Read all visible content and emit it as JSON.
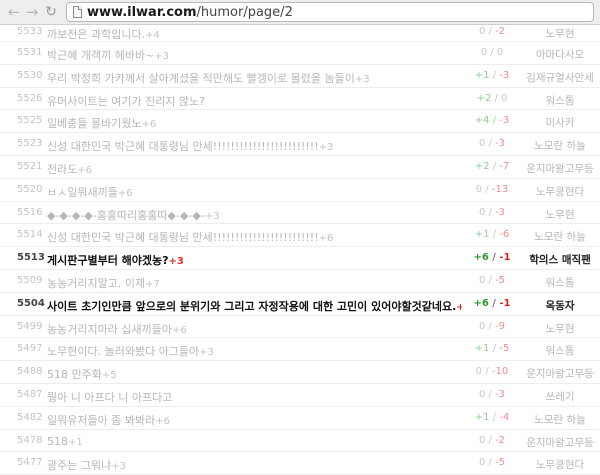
{
  "browser": {
    "url_domain": "www.ilwar.com",
    "url_path": "/humor/page/2",
    "back": "←",
    "forward": "→",
    "reload": "↻"
  },
  "posts": [
    {
      "num": "5533",
      "title": "까보전은 과학입니다.",
      "comments": "+4",
      "up": "0",
      "down": "-2",
      "author": "노무현",
      "hot": false
    },
    {
      "num": "5531",
      "title": "박근혜 개객끼 헤바바~",
      "comments": "+3",
      "up": "0",
      "down": "0",
      "author": "아마다사오",
      "hot": false
    },
    {
      "num": "5530",
      "title": "우리 박정희 가카께서 살아계셨을 적만해도 빨갱이로 몰렸을 놈들이",
      "comments": "+3",
      "up": "+1",
      "down": "-3",
      "author": "김재규열사만세",
      "hot": false
    },
    {
      "num": "5526",
      "title": "유머사이트는 여기가 진리지 않노?",
      "comments": "",
      "up": "+2",
      "down": "0",
      "author": "워스톰",
      "hot": false
    },
    {
      "num": "5525",
      "title": "일베충들 몰바기웠노",
      "comments": "+6",
      "up": "+4",
      "down": "-3",
      "author": "미사카",
      "hot": false
    },
    {
      "num": "5523",
      "title": "신성 대한민국 박근혜 대통령님 만세!!!!!!!!!!!!!!!!!!!!!!!!",
      "comments": "+3",
      "up": "0",
      "down": "-3",
      "author": "노모란 하늘",
      "hot": false
    },
    {
      "num": "5521",
      "title": "전라도",
      "comments": "+6",
      "up": "+2",
      "down": "-7",
      "author": "운지마왕고무등",
      "hot": false
    },
    {
      "num": "5520",
      "title": "ㅂㅅ일뭐새끼들",
      "comments": "+6",
      "up": "0",
      "down": "-13",
      "author": "노무쿵현다",
      "hot": false
    },
    {
      "num": "5516",
      "title": "◆-◆-◆-◆-홍홍따리홍홍따◆-◆-◆-",
      "comments": "+3",
      "up": "0",
      "down": "-3",
      "author": "노무현",
      "hot": false
    },
    {
      "num": "5514",
      "title": "신성 대한민국 박근혜 대통령님 만세!!!!!!!!!!!!!!!!!!!!!!!!",
      "comments": "+6",
      "up": "+1",
      "down": "-6",
      "author": "노모란 하늘",
      "hot": false
    },
    {
      "num": "5513",
      "title": "게시판구별부터 해야겠농?",
      "comments": "+3",
      "up": "+6",
      "down": "-1",
      "author": "학의스 매직팬",
      "hot": true
    },
    {
      "num": "5509",
      "title": "농농거리지말고. 이제",
      "comments": "+7",
      "up": "0",
      "down": "-5",
      "author": "워스톰",
      "hot": false
    },
    {
      "num": "5504",
      "title": "사이트 초기인만큼 앞으로의 분위기와 그리고 자정작용에 대한 고민이 있어야할것같네요.",
      "comments": "+7",
      "up": "+6",
      "down": "-1",
      "author": "옥동자",
      "hot": true
    },
    {
      "num": "5499",
      "title": "농농거리지마라 십새끼들아",
      "comments": "+6",
      "up": "0",
      "down": "-9",
      "author": "노무현",
      "hot": false
    },
    {
      "num": "5497",
      "title": "노무현이다. 놀러와봤다 아그들아",
      "comments": "+3",
      "up": "+1",
      "down": "-5",
      "author": "워스톰",
      "hot": false
    },
    {
      "num": "5488",
      "title": "518 민주화",
      "comments": "+5",
      "up": "0",
      "down": "-10",
      "author": "운지마왕고무등",
      "hot": false
    },
    {
      "num": "5487",
      "title": "뭥아 니 아프다 니 아프다고",
      "comments": "",
      "up": "0",
      "down": "-3",
      "author": "쓰레기",
      "hot": false
    },
    {
      "num": "5482",
      "title": "일뭐유저들아 좀 봐봐라",
      "comments": "+6",
      "up": "+1",
      "down": "-4",
      "author": "노모란 하늘",
      "hot": false
    },
    {
      "num": "5478",
      "title": "518",
      "comments": "+1",
      "up": "0",
      "down": "-2",
      "author": "운지마왕고무등",
      "hot": false
    },
    {
      "num": "5477",
      "title": "광주는 그뭐냐",
      "comments": "+3",
      "up": "0",
      "down": "-5",
      "author": "노무쿵현다",
      "hot": false
    }
  ]
}
